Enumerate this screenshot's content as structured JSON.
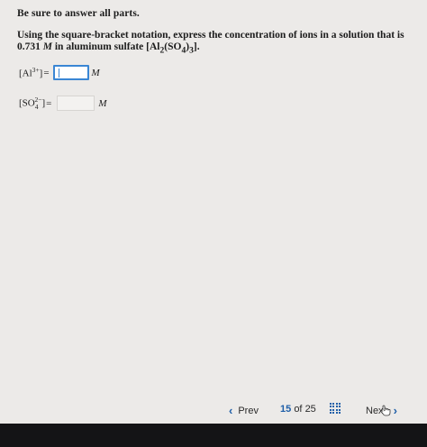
{
  "instructions": "Be sure to answer all parts.",
  "question": {
    "text_before": "Using the square-bracket notation, express the concentration of ions in a solution that is 0.731",
    "molarity_unit": "M",
    "text_after": "in aluminum sulfate"
  },
  "rows": [
    {
      "unit": "M",
      "answer_value": ""
    },
    {
      "unit": "M",
      "answer_value": ""
    }
  ],
  "nav": {
    "prev_label": "Prev",
    "current": "15",
    "of_label": "of",
    "total": "25",
    "next_label": "Next"
  },
  "colors": {
    "accent": "#1f5fa8",
    "input_border": "#3a86d4",
    "bottom_bar": "#141416"
  },
  "icons": {
    "prev": "chevron-left-icon",
    "next": "chevron-right-icon",
    "grid": "grid-icon",
    "cursor": "hand-cursor-icon"
  }
}
